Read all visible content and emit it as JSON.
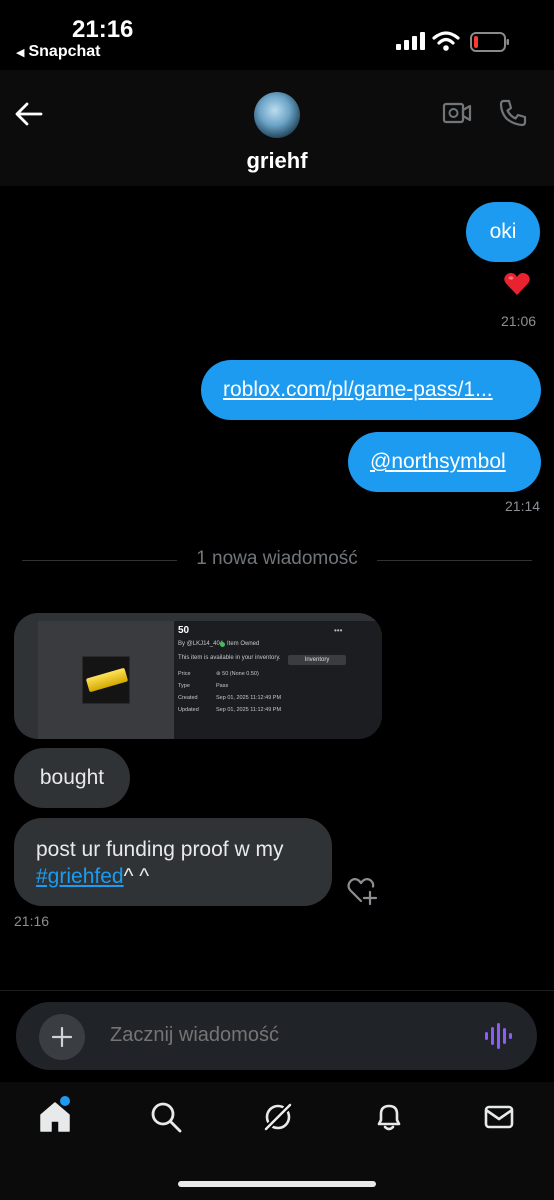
{
  "status_bar": {
    "time": "21:16",
    "back_app": "Snapchat"
  },
  "header": {
    "contact_name": "griehf",
    "icons": [
      "back-arrow-icon",
      "video-call-icon",
      "phone-call-icon"
    ]
  },
  "messages": {
    "oki": "oki",
    "oki_reaction": "heart-emoji",
    "time_1": "21:06",
    "link": "roblox.com/pl/game-pass/1...",
    "mention": "@northsymbol",
    "time_2": "21:14",
    "divider": "1 nowa wiadomość",
    "attachment": {
      "title": "50",
      "by": "By @LKJ14_404",
      "owned": "Item Owned",
      "availability": "This item is available in your inventory.",
      "inventory_button": "Inventory",
      "rows": [
        {
          "label": "Price",
          "value": "⊛ 50 (None 0.50)"
        },
        {
          "label": "Type",
          "value": "Pass"
        },
        {
          "label": "Created",
          "value": "Sep 01, 2025 11:12:49 PM"
        },
        {
          "label": "Updated",
          "value": "Sep 01, 2025 11:12:49 PM"
        }
      ]
    },
    "bought": "bought",
    "post_text": "post ur funding proof w my",
    "post_tag": "#griehfed",
    "post_suffix": "^ ^",
    "time_3": "21:16"
  },
  "composer": {
    "placeholder": "Zacznij wiadomość"
  },
  "tabs": [
    "home",
    "search",
    "grok",
    "notifications",
    "messages"
  ],
  "colors": {
    "accent": "#1d9bf0",
    "incoming_bubble": "#2f3336",
    "background": "#000000"
  }
}
